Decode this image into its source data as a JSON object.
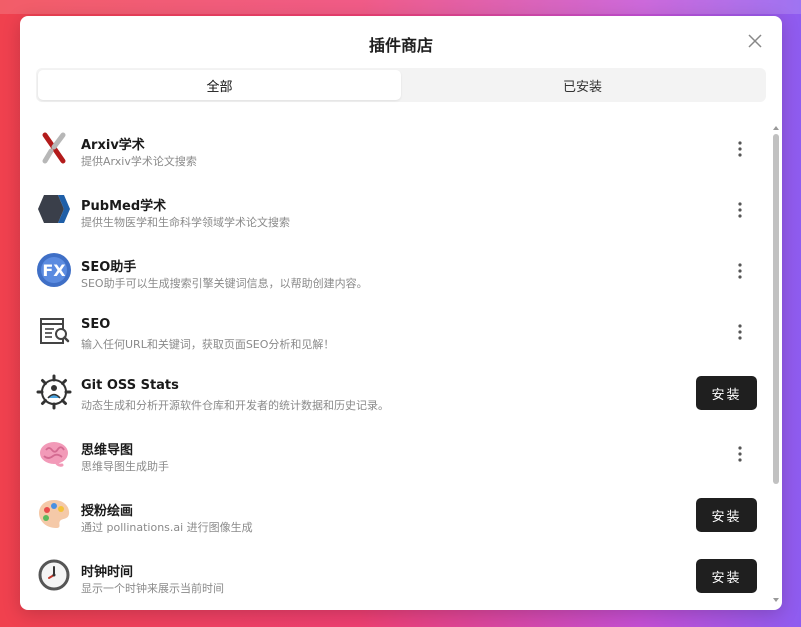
{
  "dialog": {
    "title": "插件商店"
  },
  "tabs": [
    {
      "label": "全部",
      "active": true
    },
    {
      "label": "已安装",
      "active": false
    }
  ],
  "plugins": [
    {
      "title": "Arxiv学术",
      "desc": "提供Arxiv学术论文搜索",
      "action": "more",
      "icon": "arxiv-x-icon"
    },
    {
      "title": "PubMed学术",
      "desc": "提供生物医学和生命科学领域学术论文搜索",
      "action": "more",
      "icon": "pubmed-hexagon-icon"
    },
    {
      "title": "SEO助手",
      "desc": "SEO助手可以生成搜索引擎关键词信息，以帮助创建内容。",
      "action": "more",
      "icon": "fx-globe-icon"
    },
    {
      "title": "SEO",
      "desc": "输入任何URL和关键词，获取页面SEO分析和见解！",
      "action": "more",
      "icon": "webpage-search-icon"
    },
    {
      "title": "Git OSS Stats",
      "desc": "动态生成和分析开源软件仓库和开发者的统计数据和历史记录。",
      "action": "install",
      "icon": "gear-chart-icon"
    },
    {
      "title": "思维导图",
      "desc": "思维导图生成助手",
      "action": "more",
      "icon": "brain-icon"
    },
    {
      "title": "授粉绘画",
      "desc": "通过 pollinations.ai 进行图像生成",
      "action": "install",
      "icon": "palette-icon"
    },
    {
      "title": "时钟时间",
      "desc": "显示一个时钟来展示当前时间",
      "action": "install",
      "icon": "clock-icon"
    }
  ],
  "install_label": "安装",
  "colors": {
    "install_bg": "#1f1f1f",
    "accent_gradient_start": "#f0414e",
    "accent_gradient_end": "#8e5cf0"
  }
}
